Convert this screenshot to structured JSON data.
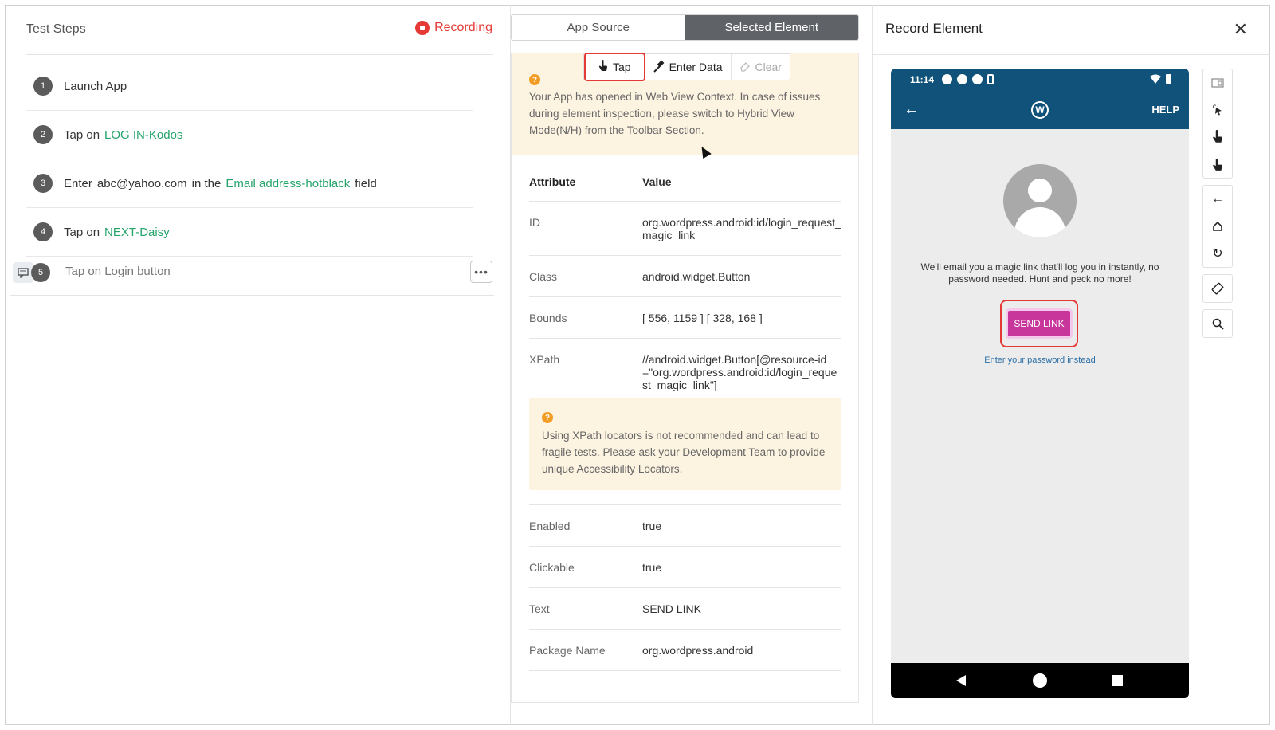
{
  "left": {
    "title": "Test Steps",
    "recording_label": "Recording",
    "steps": [
      {
        "num": "1",
        "text": "Launch App"
      },
      {
        "num": "2",
        "prefix": "Tap on",
        "target": "LOG IN-Kodos"
      },
      {
        "num": "3",
        "prefix": "Enter",
        "value": "abc@yahoo.com",
        "mid": "in the",
        "target": "Email address-hotblack",
        "suffix": "field"
      },
      {
        "num": "4",
        "prefix": "Tap on",
        "target": "NEXT-Daisy"
      },
      {
        "num": "5",
        "text": "Tap on Login button"
      }
    ],
    "more_label": "•••"
  },
  "mid": {
    "tabs": [
      "App Source",
      "Selected Element"
    ],
    "toolbar": {
      "tap": "Tap",
      "enter_data": "Enter Data",
      "clear": "Clear"
    },
    "warning_icon": "?",
    "warning": "Your App has opened in Web View Context. In case of issues during element inspection, please switch to Hybrid View Mode(N/H) from the Toolbar Section.",
    "table_head": {
      "attr": "Attribute",
      "value": "Value"
    },
    "rows": [
      {
        "k": "ID",
        "v": "org.wordpress.android:id/login_request_magic_link"
      },
      {
        "k": "Class",
        "v": "android.widget.Button"
      },
      {
        "k": "Bounds",
        "v": "[ 556, 1159 ] [ 328, 168 ]"
      },
      {
        "k": "XPath",
        "v": "//android.widget.Button[@resource-id=\"org.wordpress.android:id/login_request_magic_link\"]"
      }
    ],
    "xpath_warning": "Using XPath locators is not recommended and can lead to fragile tests. Please ask your Development Team to provide unique Accessibility Locators.",
    "rows2": [
      {
        "k": "Enabled",
        "v": "true"
      },
      {
        "k": "Clickable",
        "v": "true"
      },
      {
        "k": "Text",
        "v": "SEND LINK"
      },
      {
        "k": "Package Name",
        "v": "org.wordpress.android"
      }
    ]
  },
  "right": {
    "title": "Record Element",
    "close": "✕",
    "phone": {
      "time": "11:14",
      "help": "HELP",
      "wp": "W",
      "magic_text": "We'll email you a magic link that'll log you in instantly, no password needed. Hunt and peck no more!",
      "send_label": "SEND LINK",
      "password_link": "Enter your password instead"
    }
  },
  "colors": {
    "accent_red": "#e53935",
    "link_green": "#25a46a",
    "app_blue": "#10527a",
    "send_magenta": "#c8369b"
  }
}
